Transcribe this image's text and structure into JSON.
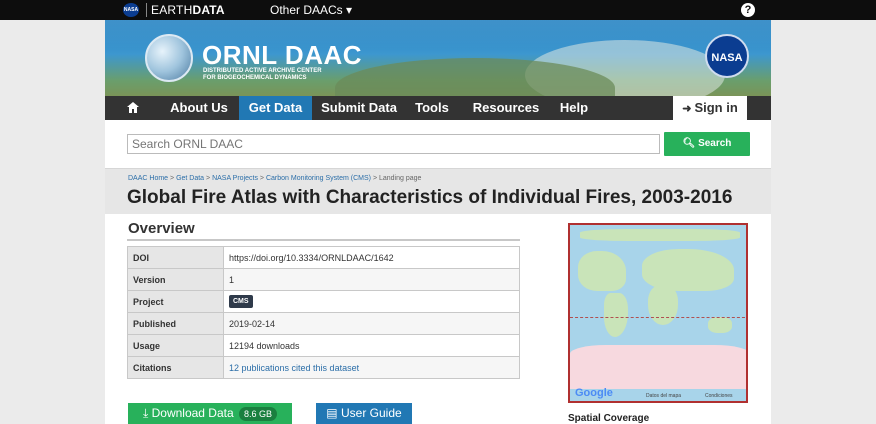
{
  "topbar": {
    "nasa_icon": "NASA",
    "brand_prefix": "EARTH",
    "brand_bold": "DATA",
    "daacs_label": "Other DAACs ▾",
    "help_icon": "?"
  },
  "banner": {
    "title": "ORNL DAAC",
    "subtitle_line1": "DISTRIBUTED ACTIVE ARCHIVE CENTER",
    "subtitle_line2": "FOR BIOGEOCHEMICAL DYNAMICS",
    "nasa_logo": "NASA"
  },
  "nav": {
    "home_icon": "home-icon",
    "items": [
      {
        "label": "About Us"
      },
      {
        "label": "Get Data",
        "active": true
      },
      {
        "label": "Submit Data"
      },
      {
        "label": "Tools"
      },
      {
        "label": "Resources"
      },
      {
        "label": "Help"
      }
    ],
    "signin": "Sign in"
  },
  "search": {
    "placeholder": "Search ORNL DAAC",
    "button": "Search"
  },
  "breadcrumb": {
    "items": [
      "DAAC Home",
      "Get Data",
      "NASA Projects",
      "Carbon Monitoring System (CMS)"
    ],
    "current": "Landing page"
  },
  "page_title": "Global Fire Atlas with Characteristics of Individual Fires, 2003-2016",
  "overview": {
    "heading": "Overview",
    "rows": [
      {
        "key": "DOI",
        "value": "https://doi.org/10.3334/ORNLDAAC/1642"
      },
      {
        "key": "Version",
        "value": "1"
      },
      {
        "key": "Project",
        "value": "CMS"
      },
      {
        "key": "Published",
        "value": "2019-02-14"
      },
      {
        "key": "Usage",
        "value": "12194 downloads"
      },
      {
        "key": "Citations",
        "value": "12 publications cited this dataset"
      }
    ]
  },
  "map": {
    "google": "Google",
    "attribution": "Datos del mapa",
    "terms": "Condiciones"
  },
  "actions": {
    "download_label": "Download Data",
    "download_size": "8.6 GB",
    "guide_label": "User Guide"
  },
  "sidebar": {
    "spatial_heading": "Spatial Coverage"
  }
}
